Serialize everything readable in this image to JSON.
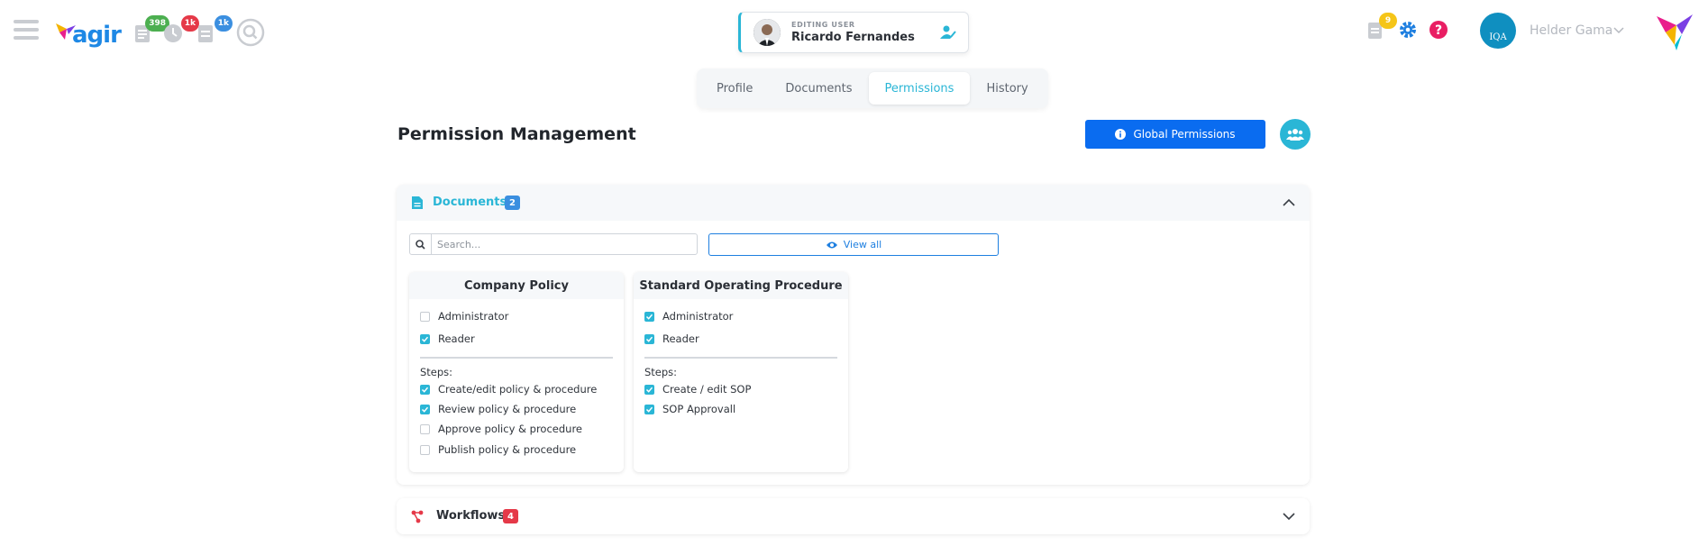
{
  "header": {
    "logo_text": "agir",
    "badges": {
      "tasks": "398",
      "clock": "1k",
      "docs": "1k",
      "notifications": "9"
    },
    "editing": {
      "label": "EDITING USER",
      "name": "Ricardo Fernandes"
    },
    "user": {
      "org": "IQA",
      "name": "Helder Gama"
    }
  },
  "tabs": [
    {
      "label": "Profile"
    },
    {
      "label": "Documents"
    },
    {
      "label": "Permissions"
    },
    {
      "label": "History"
    }
  ],
  "page": {
    "title": "Permission Management",
    "global_button": "Global Permissions"
  },
  "documents_panel": {
    "title": "Documents",
    "count": "2",
    "search_placeholder": "Search...",
    "view_all": "View all",
    "cards": [
      {
        "title": "Company Policy",
        "roles": [
          {
            "label": "Administrator",
            "checked": false
          },
          {
            "label": "Reader",
            "checked": true
          }
        ],
        "steps_label": "Steps:",
        "steps": [
          {
            "label": "Create/edit policy & procedure",
            "checked": true
          },
          {
            "label": "Review policy & procedure",
            "checked": true
          },
          {
            "label": "Approve policy & procedure",
            "checked": false
          },
          {
            "label": "Publish policy & procedure",
            "checked": false
          }
        ]
      },
      {
        "title": "Standard Operating Procedure",
        "roles": [
          {
            "label": "Administrator",
            "checked": true
          },
          {
            "label": "Reader",
            "checked": true
          }
        ],
        "steps_label": "Steps:",
        "steps": [
          {
            "label": "Create / edit SOP",
            "checked": true
          },
          {
            "label": "SOP Approvall",
            "checked": true
          }
        ]
      }
    ]
  },
  "workflows_panel": {
    "title": "Workflows",
    "count": "4"
  },
  "colors": {
    "accent": "#2ab6d6",
    "primary": "#0a6cf0",
    "danger": "#e53948"
  }
}
